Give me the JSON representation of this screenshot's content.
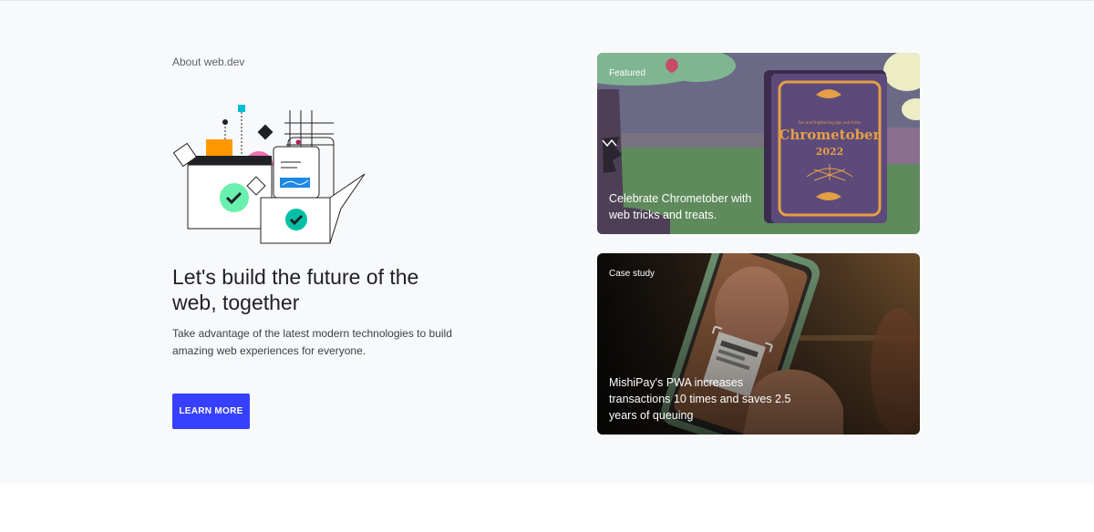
{
  "hero": {
    "eyebrow": "About web.dev",
    "headline": "Let's build the future of the web, together",
    "lede": "Take advantage of the latest modern technologies to build amazing web experiences for everyone.",
    "cta_label": "LEARN MORE",
    "cta_color": "#3740ff",
    "background": "#f8f9fa"
  },
  "cards": [
    {
      "tag": "Featured",
      "title": "Celebrate Chrometober with web tricks and treats.",
      "book_title": "Chrometober",
      "book_year": "2022",
      "book_subtitle": "Fun and frightening tips and tricks"
    },
    {
      "tag": "Case study",
      "title": "MishiPay's PWA increases transactions 10 times and saves 2.5 years of queuing"
    }
  ]
}
